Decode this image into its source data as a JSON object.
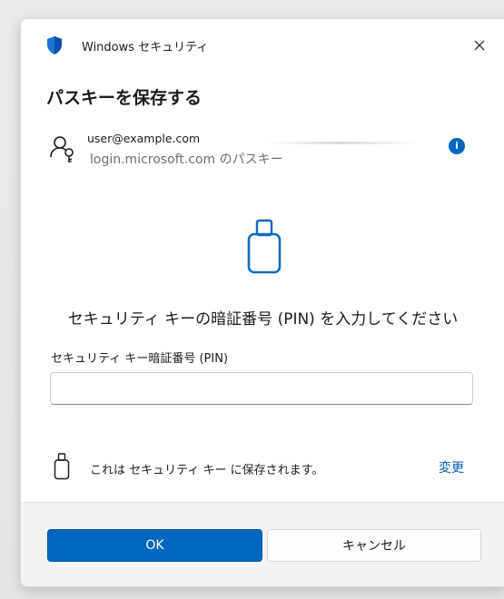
{
  "window": {
    "app_title": "Windows セキュリティ",
    "heading": "パスキーを保存する"
  },
  "account": {
    "email": "user@example.com",
    "site": "login.microsoft.com のパスキー",
    "info_glyph": "i"
  },
  "pin": {
    "prompt": "セキュリティ キーの暗証番号 (PIN) を入力してください",
    "field_label": "セキュリティ キー暗証番号 (PIN)",
    "value": "",
    "placeholder": ""
  },
  "save_location": {
    "text": "これは セキュリティ キー に保存されます。",
    "change_label": "変更"
  },
  "buttons": {
    "ok": "OK",
    "cancel": "キャンセル"
  },
  "colors": {
    "accent": "#0067c0",
    "link": "#005fb8",
    "icon_outline": "#0f6cbd"
  },
  "icons": [
    "windows-security-shield-icon",
    "close-icon",
    "key-person-icon",
    "info-icon",
    "usb-security-key-icon"
  ]
}
